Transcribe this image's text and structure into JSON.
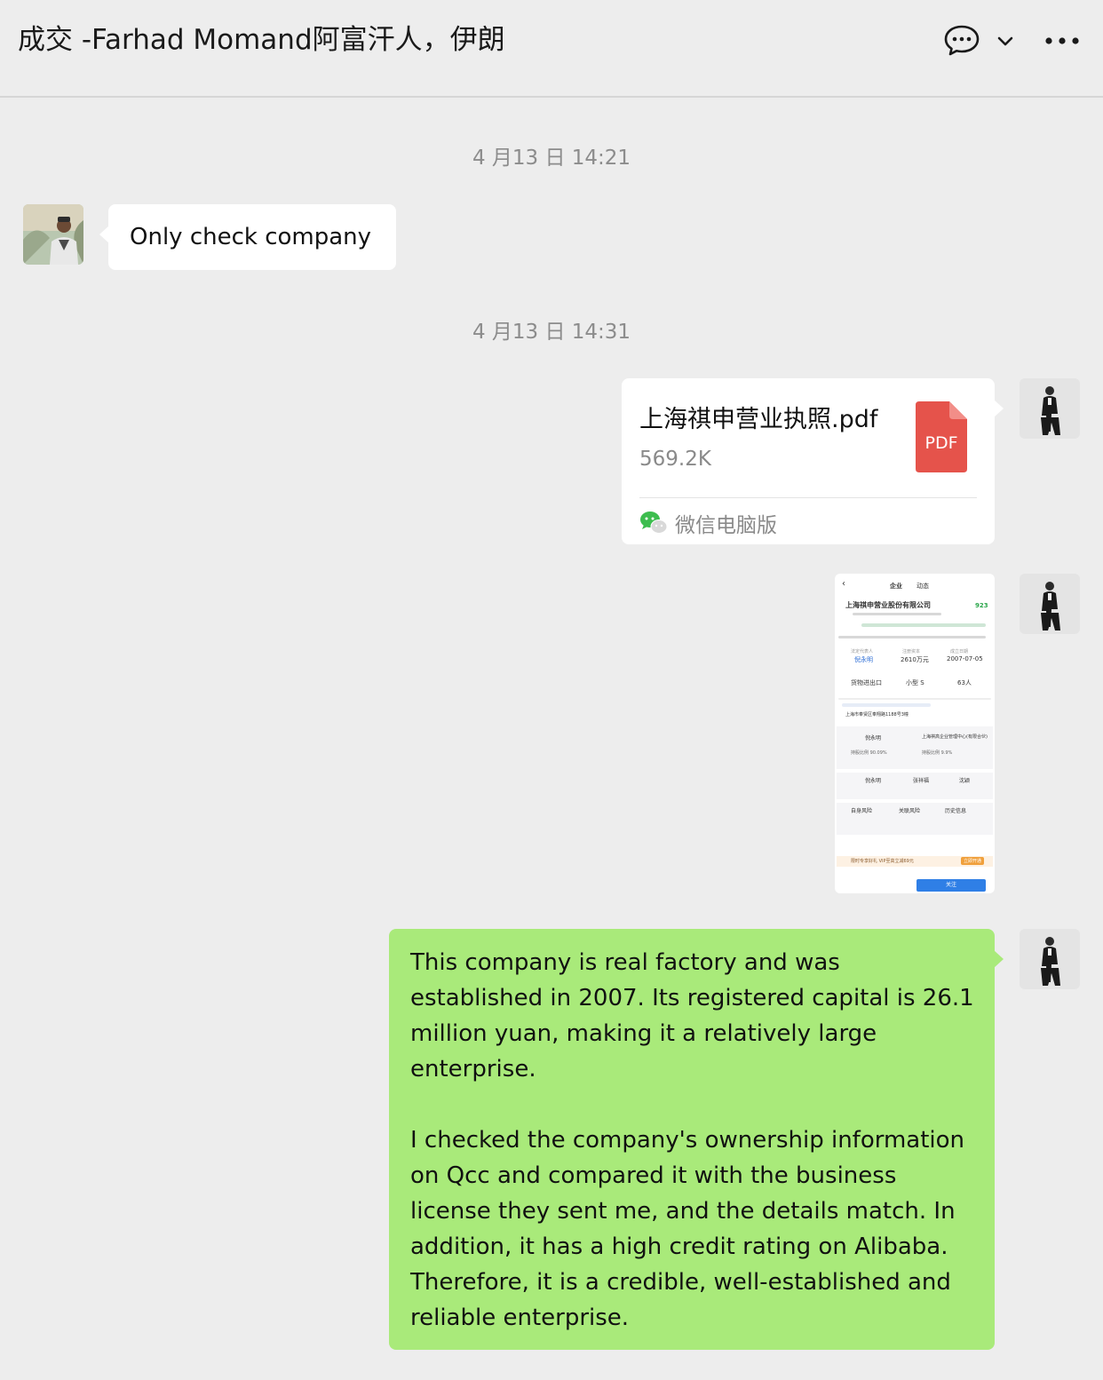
{
  "header": {
    "title": "成交 -Farhad Momand阿富汗人，伊朗",
    "icons": [
      "chat-bubble-icon",
      "chevron-down-icon",
      "more-icon"
    ]
  },
  "messages": {
    "time1": "4 月13 日 14:21",
    "msg1_text": "Only check company",
    "time2": "4 月13 日 14:31",
    "file": {
      "name": "上海祺申营业执照.pdf",
      "size": "569.2K",
      "type_label": "PDF",
      "source": "微信电脑版"
    },
    "screenshot": {
      "tab_company": "企业",
      "tab_news": "动态",
      "company_name": "上海祺申营业股份有限公司",
      "score": "923",
      "legal_rep_label": "法定代表人",
      "legal_rep": "倪永明",
      "capital_label": "注册资本",
      "capital": "2610万元",
      "founded_label": "成立日期",
      "founded": "2007-07-05",
      "industry": "货物进出口",
      "scale": "小型 S",
      "staff": "63人",
      "address": "上海市奉贤区奉翔路1188号3幢",
      "shareholder1": "倪永明",
      "shareholder1_pct": "持股比例 90.09%",
      "shareholder2": "上海祺高企业管理中心(有限合伙)",
      "shareholder2_pct": "持股比例 9.9%",
      "person2": "张祥福",
      "person3": "沈颖",
      "risk1": "自身风险",
      "risk2": "关联风险",
      "risk3": "历史信息",
      "promo": "限时专享好礼 VIP至高立减69元",
      "promo_btn": "立即开通",
      "follow_btn": "关注"
    },
    "msg3_paragraph1": "This company is real factory and was established in 2007. Its registered capital is 26.1 million yuan, making it a relatively large enterprise.",
    "msg3_paragraph2": "I checked the company's ownership information on Qcc and compared it with the business license they sent me, and the details match. In addition, it has a high credit rating on Alibaba. Therefore, it is a credible, well-established and reliable enterprise."
  },
  "colors": {
    "background": "#ededed",
    "bubble_self": "#a9ea7a",
    "bubble_other": "#ffffff",
    "pdf_red": "#e5534b",
    "timestamp": "#8c8c8c"
  }
}
